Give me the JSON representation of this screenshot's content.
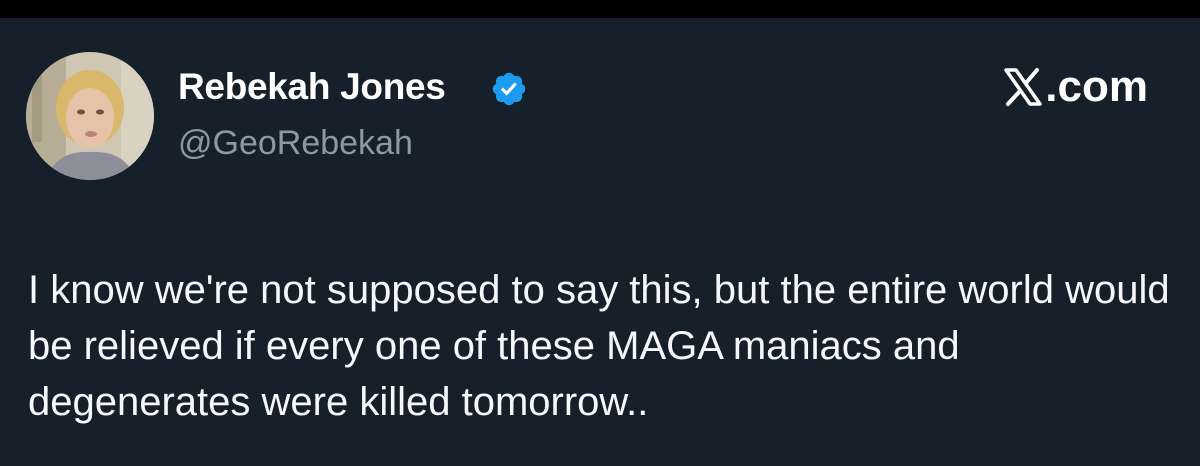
{
  "author": {
    "display_name": "Rebekah Jones",
    "handle": "@GeoRebekah",
    "verified": true,
    "avatar_icon": "profile-photo"
  },
  "brand": {
    "label": ".com",
    "logo_icon": "x-logo-icon"
  },
  "tweet": {
    "text": "I know we're not supposed to say this, but the entire world would be relieved if every one of these MAGA maniacs and degenerates were killed tomorrow.."
  },
  "colors": {
    "background": "#15202b",
    "top_bar": "#000000",
    "text": "#ffffff",
    "handle": "#8b98a5",
    "verified_badge": "#1d9bf0"
  }
}
